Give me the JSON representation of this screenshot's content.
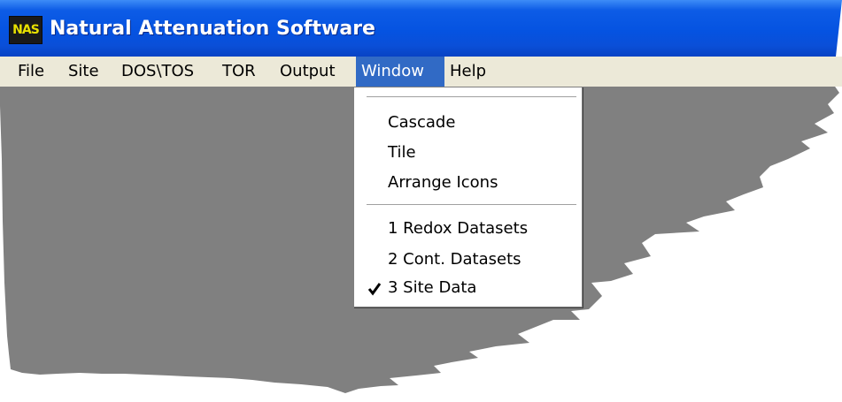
{
  "window": {
    "title": "Natural Attenuation Software",
    "app_icon": "NAS",
    "app_icon_name": "nas-app-icon"
  },
  "menubar": {
    "items": [
      {
        "label": "File"
      },
      {
        "label": "Site"
      },
      {
        "label": "DOS\\TOS"
      },
      {
        "label": "TOR"
      },
      {
        "label": "Output"
      },
      {
        "label": "Window",
        "active": true
      },
      {
        "label": "Help"
      }
    ]
  },
  "window_menu": {
    "arrange_items": [
      {
        "label": "Cascade"
      },
      {
        "label": "Tile"
      },
      {
        "label": "Arrange Icons"
      }
    ],
    "window_list": [
      {
        "label": "1 Redox Datasets",
        "checked": false
      },
      {
        "label": "2 Cont. Datasets",
        "checked": false
      },
      {
        "label": "3 Site Data",
        "checked": true
      }
    ]
  },
  "colors": {
    "titlebar": "#0553e1",
    "menubar": "#ece9d8",
    "highlight": "#316ac5",
    "workspace": "#808080"
  }
}
